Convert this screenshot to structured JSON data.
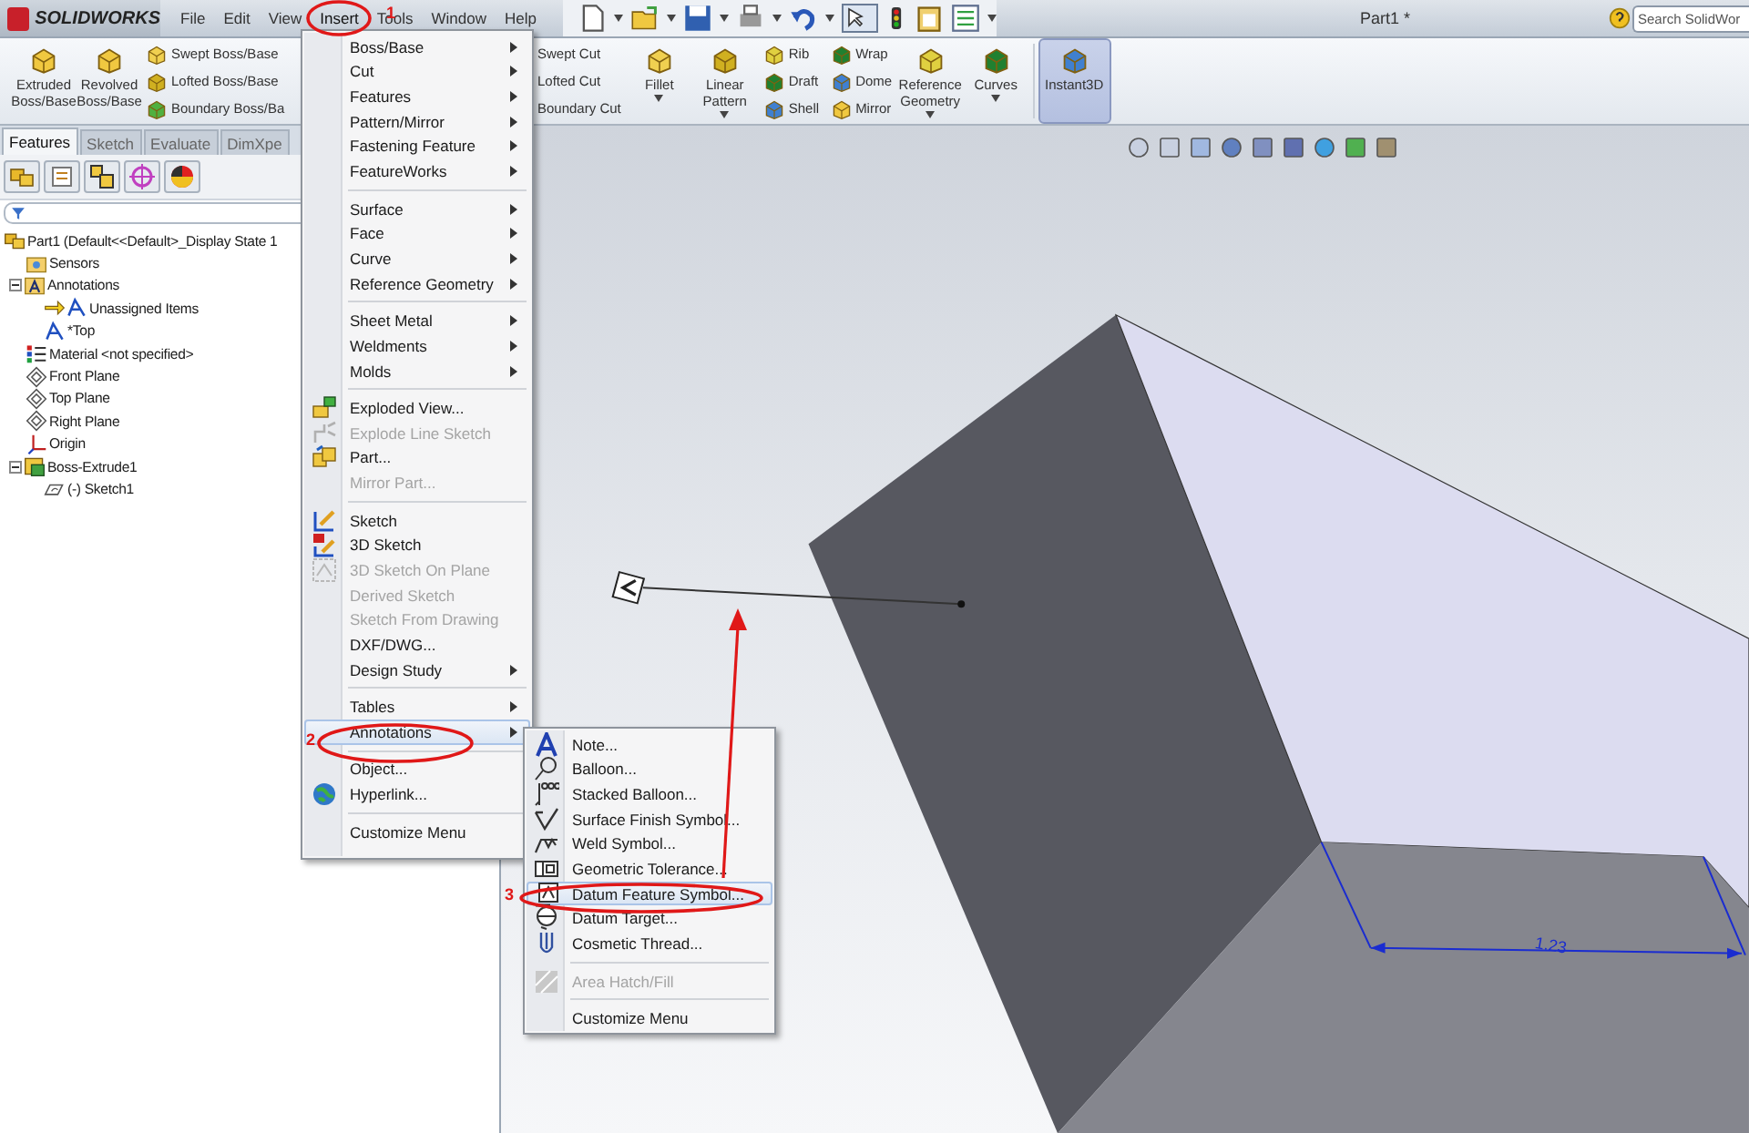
{
  "app": {
    "logo": "SOLIDWORKS",
    "menu": [
      {
        "label": "File",
        "selected": false
      },
      {
        "label": "Edit",
        "selected": false
      },
      {
        "label": "View",
        "selected": false
      },
      {
        "label": "Insert",
        "selected": true
      },
      {
        "label": "Tools",
        "selected": false
      },
      {
        "label": "Window",
        "selected": false
      },
      {
        "label": "Help",
        "selected": false
      }
    ],
    "document_title": "Part1 *",
    "search": {
      "placeholder": "Search SolidWor"
    }
  },
  "ribbon": [
    {
      "kind": "large",
      "label": "Extruded Boss/Base",
      "selected": false,
      "dropdown": false
    },
    {
      "kind": "large",
      "label": "Revolved Boss/Base",
      "selected": false,
      "dropdown": false
    },
    {
      "kind": "stack",
      "wide": true,
      "items": [
        "Swept Boss/Base",
        "Lofted Boss/Base",
        "Boundary Boss/Ba"
      ]
    },
    {
      "kind": "stack",
      "wide": false,
      "items": [
        "Swept Cut",
        "Lofted Cut",
        "Boundary Cut"
      ]
    },
    {
      "kind": "large",
      "label": "Fillet",
      "selected": false,
      "dropdown": true
    },
    {
      "kind": "large",
      "label": "Linear Pattern",
      "selected": false,
      "dropdown": true
    },
    {
      "kind": "stack",
      "wide": false,
      "items": [
        "Rib",
        "Draft",
        "Shell"
      ]
    },
    {
      "kind": "stack",
      "wide": false,
      "items": [
        "Wrap",
        "Dome",
        "Mirror"
      ]
    },
    {
      "kind": "large",
      "label": "Reference Geometry",
      "selected": false,
      "dropdown": true
    },
    {
      "kind": "large",
      "label": "Curves",
      "selected": false,
      "dropdown": true
    },
    {
      "kind": "large",
      "label": "Instant3D",
      "selected": true,
      "dropdown": false
    }
  ],
  "panel_tabs": [
    {
      "label": "Features",
      "selected": true
    },
    {
      "label": "Sketch",
      "selected": false
    },
    {
      "label": "Evaluate",
      "selected": false
    },
    {
      "label": "DimXpe",
      "selected": false
    }
  ],
  "feature_tree": {
    "label": "Part1  (Default<<Default>_Display State 1",
    "kind": "part",
    "children": [
      {
        "label": "Sensors",
        "kind": "folder"
      },
      {
        "label": "Annotations",
        "kind": "annotations",
        "expanded": true,
        "children": [
          {
            "label": "Unassigned Items",
            "kind": "view-arrow"
          },
          {
            "label": "*Top",
            "kind": "view"
          }
        ]
      },
      {
        "label": "Material <not specified>",
        "kind": "material"
      },
      {
        "label": "Front Plane",
        "kind": "plane"
      },
      {
        "label": "Top Plane",
        "kind": "plane"
      },
      {
        "label": "Right Plane",
        "kind": "plane"
      },
      {
        "label": "Origin",
        "kind": "origin"
      },
      {
        "label": "Boss-Extrude1",
        "kind": "feature",
        "expanded": true,
        "children": [
          {
            "label": "(-) Sketch1",
            "kind": "sketch"
          }
        ]
      }
    ]
  },
  "insert_menu": [
    {
      "kind": "item",
      "label": "Boss/Base",
      "submenu": true,
      "disabled": false,
      "selected": false
    },
    {
      "kind": "item",
      "label": "Cut",
      "submenu": true,
      "disabled": false,
      "selected": false
    },
    {
      "kind": "item",
      "label": "Features",
      "submenu": true,
      "disabled": false,
      "selected": false
    },
    {
      "kind": "item",
      "label": "Pattern/Mirror",
      "submenu": true,
      "disabled": false,
      "selected": false
    },
    {
      "kind": "item",
      "label": "Fastening Feature",
      "submenu": true,
      "disabled": false,
      "selected": false
    },
    {
      "kind": "item",
      "label": "FeatureWorks",
      "submenu": true,
      "disabled": false,
      "selected": false
    },
    {
      "kind": "separator"
    },
    {
      "kind": "item",
      "label": "Surface",
      "submenu": true,
      "disabled": false,
      "selected": false
    },
    {
      "kind": "item",
      "label": "Face",
      "submenu": true,
      "disabled": false,
      "selected": false
    },
    {
      "kind": "item",
      "label": "Curve",
      "submenu": true,
      "disabled": false,
      "selected": false
    },
    {
      "kind": "item",
      "label": "Reference Geometry",
      "submenu": true,
      "disabled": false,
      "selected": false
    },
    {
      "kind": "separator"
    },
    {
      "kind": "item",
      "label": "Sheet Metal",
      "submenu": true,
      "disabled": false,
      "selected": false
    },
    {
      "kind": "item",
      "label": "Weldments",
      "submenu": true,
      "disabled": false,
      "selected": false
    },
    {
      "kind": "item",
      "label": "Molds",
      "submenu": true,
      "disabled": false,
      "selected": false
    },
    {
      "kind": "separator"
    },
    {
      "kind": "item",
      "label": "Exploded View...",
      "submenu": false,
      "disabled": false,
      "selected": false
    },
    {
      "kind": "item",
      "label": "Explode Line Sketch",
      "submenu": false,
      "disabled": true,
      "selected": false
    },
    {
      "kind": "item",
      "label": "Part...",
      "submenu": false,
      "disabled": false,
      "selected": false
    },
    {
      "kind": "item",
      "label": "Mirror Part...",
      "submenu": false,
      "disabled": true,
      "selected": false
    },
    {
      "kind": "separator"
    },
    {
      "kind": "item",
      "label": "Sketch",
      "submenu": false,
      "disabled": false,
      "selected": false
    },
    {
      "kind": "item",
      "label": "3D Sketch",
      "submenu": false,
      "disabled": false,
      "selected": false
    },
    {
      "kind": "item",
      "label": "3D Sketch On Plane",
      "submenu": false,
      "disabled": true,
      "selected": false
    },
    {
      "kind": "item",
      "label": "Derived Sketch",
      "submenu": false,
      "disabled": true,
      "selected": false
    },
    {
      "kind": "item",
      "label": "Sketch From Drawing",
      "submenu": false,
      "disabled": true,
      "selected": false
    },
    {
      "kind": "item",
      "label": "DXF/DWG...",
      "submenu": false,
      "disabled": false,
      "selected": false
    },
    {
      "kind": "item",
      "label": "Design Study",
      "submenu": true,
      "disabled": false,
      "selected": false
    },
    {
      "kind": "separator"
    },
    {
      "kind": "item",
      "label": "Tables",
      "submenu": true,
      "disabled": false,
      "selected": false
    },
    {
      "kind": "item",
      "label": "Annotations",
      "submenu": true,
      "disabled": false,
      "selected": true
    },
    {
      "kind": "separator"
    },
    {
      "kind": "item",
      "label": "Object...",
      "submenu": false,
      "disabled": false,
      "selected": false
    },
    {
      "kind": "item",
      "label": "Hyperlink...",
      "submenu": false,
      "disabled": false,
      "selected": false
    },
    {
      "kind": "separator"
    },
    {
      "kind": "item",
      "label": "Customize Menu",
      "submenu": false,
      "disabled": false,
      "selected": false
    }
  ],
  "annotations_submenu": [
    {
      "kind": "item",
      "label": "Note...",
      "disabled": false,
      "selected": false
    },
    {
      "kind": "item",
      "label": "Balloon...",
      "disabled": false,
      "selected": false
    },
    {
      "kind": "item",
      "label": "Stacked Balloon...",
      "disabled": false,
      "selected": false
    },
    {
      "kind": "item",
      "label": "Surface Finish Symbol...",
      "disabled": false,
      "selected": false
    },
    {
      "kind": "item",
      "label": "Weld Symbol...",
      "disabled": false,
      "selected": false
    },
    {
      "kind": "item",
      "label": "Geometric Tolerance...",
      "disabled": false,
      "selected": false
    },
    {
      "kind": "item",
      "label": "Datum Feature Symbol...",
      "disabled": false,
      "selected": true
    },
    {
      "kind": "item",
      "label": "Datum Target...",
      "disabled": false,
      "selected": false
    },
    {
      "kind": "item",
      "label": "Cosmetic Thread...",
      "disabled": false,
      "selected": false
    },
    {
      "kind": "separator"
    },
    {
      "kind": "item",
      "label": "Area Hatch/Fill",
      "disabled": true,
      "selected": false
    },
    {
      "kind": "separator"
    },
    {
      "kind": "item",
      "label": "Customize Menu",
      "disabled": false,
      "selected": false
    }
  ],
  "viewport": {
    "dimension": "1.23"
  },
  "callouts": [
    {
      "label": "1"
    },
    {
      "label": "2"
    },
    {
      "label": "3"
    }
  ]
}
